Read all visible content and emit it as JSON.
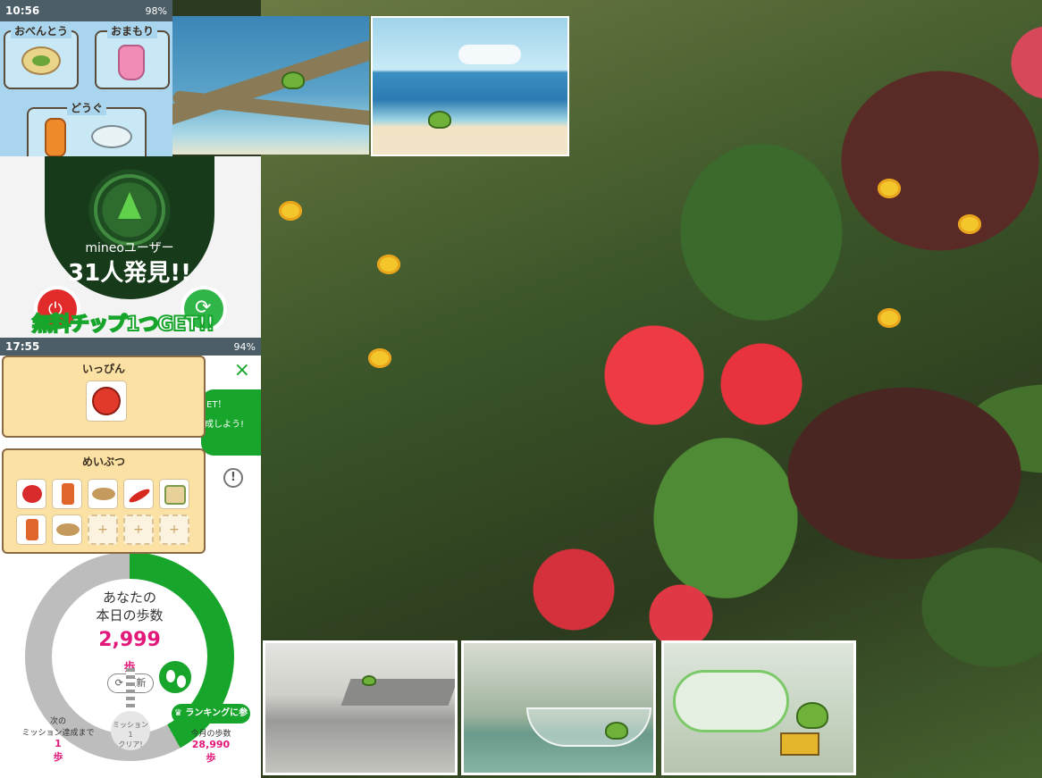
{
  "screen_items": {
    "status": {
      "time": "10:56",
      "battery": "98%"
    },
    "slots": {
      "bento": "おべんとう",
      "omamori": "おまもり",
      "dougu": "どうぐ"
    }
  },
  "screen_radar": {
    "user_label": "mineoユーザー",
    "count_text": "31人発見!!",
    "banner": "無料チップ1つGET!!"
  },
  "screen_steps": {
    "status": {
      "time": "17:55",
      "battery": "94%"
    },
    "close": "×",
    "pill_line1": "ET！",
    "pill_line2": "成しよう!",
    "info": "!",
    "card_ippin": {
      "title": "いっぴん"
    },
    "card_meibutsu": {
      "title": "めいぶつ",
      "empty_slot": "+"
    },
    "gauge": {
      "line1": "あなたの",
      "line2": "本日の歩数",
      "value": "2,999",
      "unit": "歩",
      "refresh": "更新",
      "progress_fraction": 0.42
    },
    "next_mission": {
      "line1": "次の",
      "line2": "ミッション達成まで",
      "value": "1",
      "unit": "歩"
    },
    "mission_badge": {
      "line1": "ミッション1",
      "line2": "クリア!"
    },
    "ranking_button": "ランキングに参加",
    "monthly": {
      "label": "今月の歩数",
      "value": "28,990",
      "unit": "歩"
    }
  },
  "colors": {
    "accent_green": "#17a52c",
    "step_pink": "#e2187a",
    "sky_panel": "#a9d6ee"
  }
}
